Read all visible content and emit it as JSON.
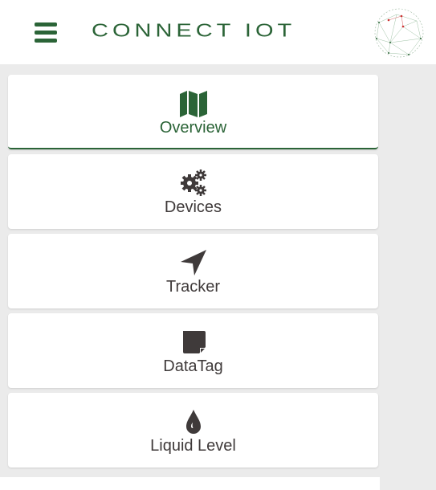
{
  "header": {
    "logo_text": "CONNECT IOT",
    "menu_icon": "hamburger-icon",
    "brand_color": "#2b6437"
  },
  "nav": {
    "items": [
      {
        "label": "Overview",
        "icon": "map-icon",
        "active": true
      },
      {
        "label": "Devices",
        "icon": "cogs-icon",
        "active": false
      },
      {
        "label": "Tracker",
        "icon": "location-arrow-icon",
        "active": false
      },
      {
        "label": "DataTag",
        "icon": "sticky-note-icon",
        "active": false
      },
      {
        "label": "Liquid Level",
        "icon": "tint-icon",
        "active": false
      }
    ]
  }
}
